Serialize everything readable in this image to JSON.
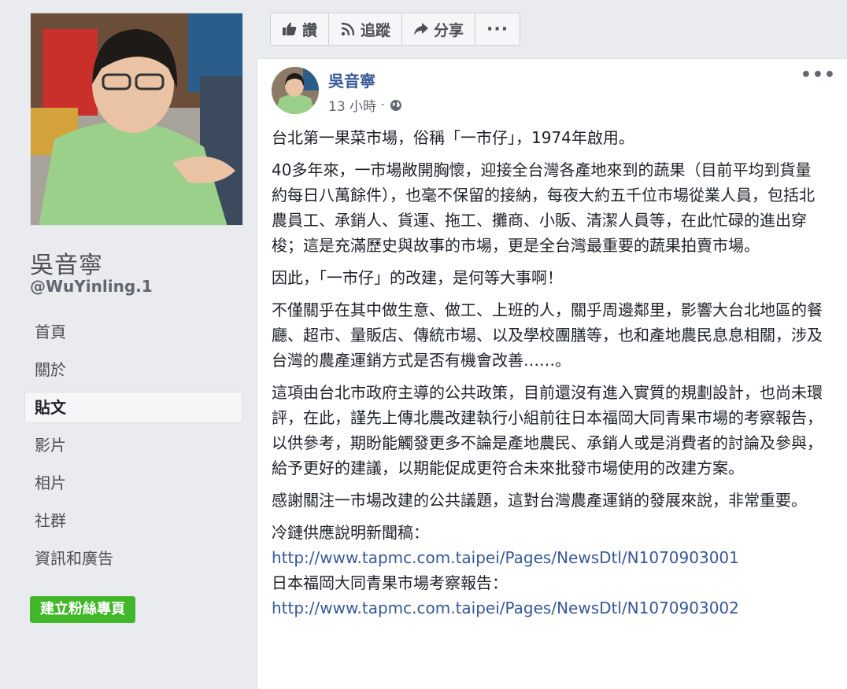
{
  "page": {
    "name": "吳音寧",
    "handle": "@WuYinling.1"
  },
  "nav": [
    {
      "label": "首頁"
    },
    {
      "label": "關於"
    },
    {
      "label": "貼文"
    },
    {
      "label": "影片"
    },
    {
      "label": "相片"
    },
    {
      "label": "社群"
    },
    {
      "label": "資訊和廣告"
    }
  ],
  "create_page_label": "建立粉絲專頁",
  "toolbar": {
    "like_label": "讚",
    "follow_label": "追蹤",
    "share_label": "分享",
    "more_label": "···"
  },
  "post": {
    "author": "吳音寧",
    "time": "13 小時",
    "menu_label": "•••",
    "paragraphs": [
      "台北第一果菜市場，俗稱「一市仔」，1974年啟用。",
      "40多年來，一市場敞開胸懷，迎接全台灣各產地來到的蔬果（目前平均到貨量約每日八萬餘件），也毫不保留的接納，每夜大約五千位市場從業人員，包括北農員工、承銷人、貨運、拖工、攤商、小販、清潔人員等，在此忙碌的進出穿梭；這是充滿歷史與故事的市場，更是全台灣最重要的蔬果拍賣市場。",
      "因此，「一市仔」的改建，是何等大事啊！",
      "不僅關乎在其中做生意、做工、上班的人，關乎周邊鄰里，影響大台北地區的餐廳、超市、量販店、傳統市場、以及學校團膳等，也和產地農民息息相關，涉及台灣的農產運銷方式是否有機會改善……。",
      "這項由台北市政府主導的公共政策，目前還沒有進入實質的規劃設計，也尚未環評，在此，謹先上傳北農改建執行小組前往日本福岡大同青果市場的考察報告，以供參考，期盼能觸發更多不論是產地農民、承銷人或是消費者的討論及參與，給予更好的建議，以期能促成更符合未來批發市場使用的改建方案。",
      "感謝關注一市場改建的公共議題，這對台灣農產運銷的發展來說，非常重要。"
    ],
    "link1_caption": "冷鏈供應說明新聞稿：",
    "link1_url": "http://www.tapmc.com.taipei/Pages/NewsDtl/N1070903001",
    "link2_caption": "日本福岡大同青果市場考察報告：",
    "link2_url": "http://www.tapmc.com.taipei/Pages/NewsDtl/N1070903002"
  },
  "icons": [
    "thumbs-up-icon",
    "rss-icon",
    "share-arrow-icon",
    "globe-icon"
  ],
  "colors": {
    "link": "#385898",
    "green_button": "#42b72a",
    "background": "#e9ebee"
  }
}
